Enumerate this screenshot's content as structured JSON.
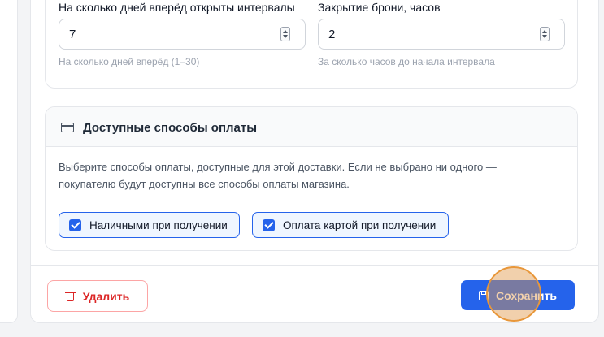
{
  "interval_settings": {
    "days_ahead": {
      "label": "На сколько дней вперёд открыты интервалы",
      "value": "7",
      "hint": "На сколько дней вперёд (1–30)"
    },
    "booking_close": {
      "label": "Закрытие брони, часов",
      "value": "2",
      "hint": "За сколько часов до начала интервала"
    }
  },
  "payment": {
    "icon": "credit-card-icon",
    "title": "Доступные способы оплаты",
    "description": "Выберите способы оплаты, доступные для этой доставки. Если не выбрано ни одного — покупателю будут доступны все способы оплаты магазина.",
    "options": [
      {
        "label": "Наличными при получении",
        "checked": true
      },
      {
        "label": "Оплата картой при получении",
        "checked": true
      }
    ]
  },
  "footer": {
    "delete_label": "Удалить",
    "delete_icon": "trash-icon",
    "save_label": "Сохранить",
    "save_icon": "floppy-disk-icon"
  },
  "colors": {
    "accent": "#2563eb",
    "danger": "#dc2626",
    "click_highlight": "#e8973a"
  }
}
